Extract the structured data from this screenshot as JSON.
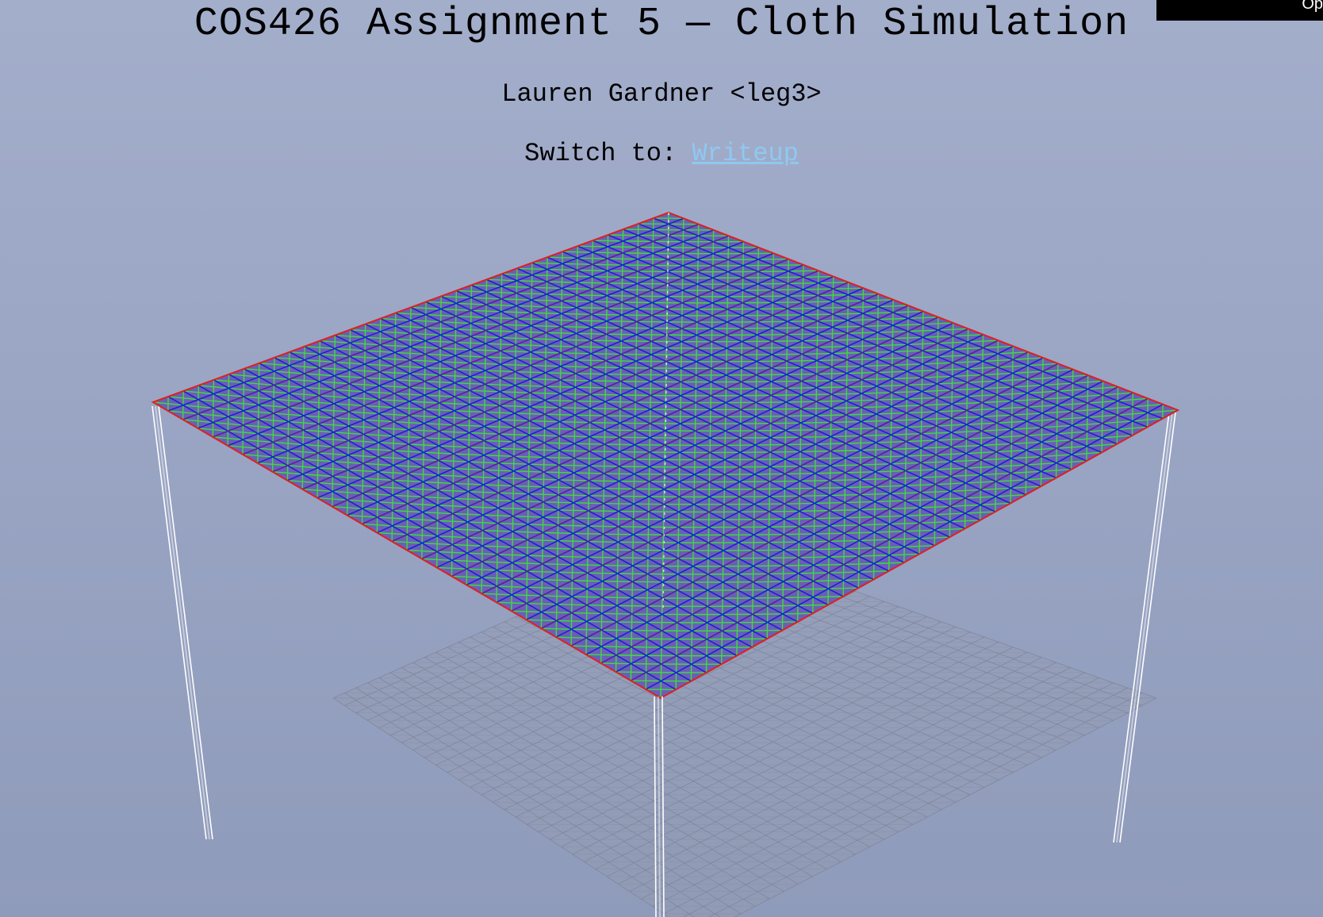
{
  "page": {
    "title": "COS426 Assignment 5 — Cloth Simulation",
    "author": "Lauren Gardner <leg3>",
    "switch_prefix": "Switch to:",
    "switch_link": "Writeup",
    "gui_toggle_label": "Op"
  },
  "scene": {
    "background_top": "#a3aecb",
    "background_bottom": "#8f9bba",
    "cloth_structural_color": "#1f1fd6",
    "cloth_shear_color": "#3ddc3d",
    "cloth_bend_color": "#e02020",
    "cloth_fill_color": "#6a5fb8",
    "pole_color": "#ffffff",
    "ground_grid_color": "#7d859a",
    "link_color": "#8ec9f0"
  }
}
